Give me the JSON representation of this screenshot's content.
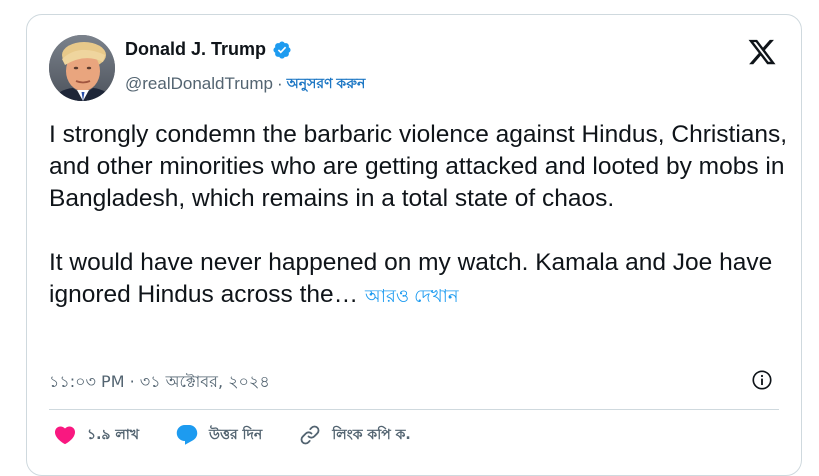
{
  "author": {
    "display_name": "Donald J. Trump",
    "handle": "@realDonaldTrump",
    "separator": "·",
    "follow_label": "অনুসরণ করুন"
  },
  "tweet": {
    "paragraph_1": "I strongly condemn the barbaric violence against Hindus, Christians, and other minorities who are getting attacked and looted by mobs in Bangladesh, which remains in a total state of chaos.",
    "paragraph_2": "It would have never happened on my watch. Kamala and Joe have ignored Hindus across the…",
    "show_more_label": "আরও দেখান"
  },
  "meta": {
    "time": "১১:০৩ PM",
    "separator": "·",
    "date": "৩১ অক্টোবর, ২০২৪"
  },
  "actions": {
    "like_count": "১.৯ লাখ",
    "reply_label": "উত্তর দিন",
    "copy_link_label": "লিংক কপি ক."
  },
  "icons": {
    "like": "heart-icon",
    "reply": "reply-bubble-icon",
    "copy_link": "link-icon",
    "info": "info-icon",
    "brand": "x-logo-icon",
    "verified": "verified-badge-icon"
  },
  "colors": {
    "verified_blue": "#1d9bf0",
    "like_pink": "#f91880",
    "reply_blue": "#1d9bf0",
    "link_blue": "#1d9bf0",
    "text_primary": "#0f1419",
    "text_secondary": "#536471",
    "border": "#cfd9de"
  }
}
